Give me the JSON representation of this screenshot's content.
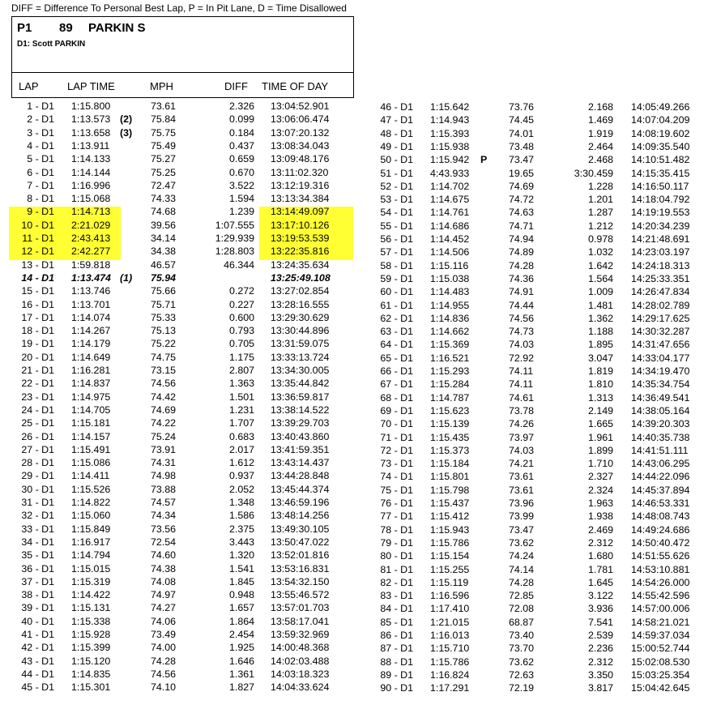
{
  "legend": "DIFF = Difference To Personal Best Lap,   P = In Pit Lane,   D = Time Disallowed",
  "header": {
    "position": "P1",
    "car_number": "89",
    "name": "PARKIN S",
    "driver": "D1:    Scott PARKIN"
  },
  "columns": {
    "lap": "LAP",
    "lap_time": "LAP TIME",
    "mph": "MPH",
    "diff": "DIFF",
    "time_of_day": "TIME OF DAY"
  },
  "colors": {
    "highlight": "#ffff33"
  },
  "laps_left": [
    {
      "lap": "1 - D1",
      "time": "1:15.800",
      "flag": "",
      "mph": "73.61",
      "diff": "2.326",
      "tod": "13:04:52.901"
    },
    {
      "lap": "2 - D1",
      "time": "1:13.573",
      "flag": "(2)",
      "mph": "75.84",
      "diff": "0.099",
      "tod": "13:06:06.474"
    },
    {
      "lap": "3 - D1",
      "time": "1:13.658",
      "flag": "(3)",
      "mph": "75.75",
      "diff": "0.184",
      "tod": "13:07:20.132"
    },
    {
      "lap": "4 - D1",
      "time": "1:13.911",
      "flag": "",
      "mph": "75.49",
      "diff": "0.437",
      "tod": "13:08:34.043"
    },
    {
      "lap": "5 - D1",
      "time": "1:14.133",
      "flag": "",
      "mph": "75.27",
      "diff": "0.659",
      "tod": "13:09:48.176"
    },
    {
      "lap": "6 - D1",
      "time": "1:14.144",
      "flag": "",
      "mph": "75.25",
      "diff": "0.670",
      "tod": "13:11:02.320"
    },
    {
      "lap": "7 - D1",
      "time": "1:16.996",
      "flag": "",
      "mph": "72.47",
      "diff": "3.522",
      "tod": "13:12:19.316"
    },
    {
      "lap": "8 - D1",
      "time": "1:15.068",
      "flag": "",
      "mph": "74.33",
      "diff": "1.594",
      "tod": "13:13:34.384"
    },
    {
      "lap": "9 - D1",
      "time": "1:14.713",
      "flag": "",
      "mph": "74.68",
      "diff": "1.239",
      "tod": "13:14:49.097"
    },
    {
      "lap": "10 - D1",
      "time": "2:21.029",
      "flag": "",
      "mph": "39.56",
      "diff": "1:07.555",
      "tod": "13:17:10.126"
    },
    {
      "lap": "11 - D1",
      "time": "2:43.413",
      "flag": "",
      "mph": "34.14",
      "diff": "1:29.939",
      "tod": "13:19:53.539"
    },
    {
      "lap": "12 - D1",
      "time": "2:42.277",
      "flag": "",
      "mph": "34.38",
      "diff": "1:28.803",
      "tod": "13:22:35.816"
    },
    {
      "lap": "13 - D1",
      "time": "1:59.818",
      "flag": "",
      "mph": "46.57",
      "diff": "46.344",
      "tod": "13:24:35.634"
    },
    {
      "lap": "14 - D1",
      "time": "1:13.474",
      "flag": "(1)",
      "mph": "75.94",
      "diff": "",
      "tod": "13:25:49.108",
      "best": true
    },
    {
      "lap": "15 - D1",
      "time": "1:13.746",
      "flag": "",
      "mph": "75.66",
      "diff": "0.272",
      "tod": "13:27:02.854"
    },
    {
      "lap": "16 - D1",
      "time": "1:13.701",
      "flag": "",
      "mph": "75.71",
      "diff": "0.227",
      "tod": "13:28:16.555"
    },
    {
      "lap": "17 - D1",
      "time": "1:14.074",
      "flag": "",
      "mph": "75.33",
      "diff": "0.600",
      "tod": "13:29:30.629"
    },
    {
      "lap": "18 - D1",
      "time": "1:14.267",
      "flag": "",
      "mph": "75.13",
      "diff": "0.793",
      "tod": "13:30:44.896"
    },
    {
      "lap": "19 - D1",
      "time": "1:14.179",
      "flag": "",
      "mph": "75.22",
      "diff": "0.705",
      "tod": "13:31:59.075"
    },
    {
      "lap": "20 - D1",
      "time": "1:14.649",
      "flag": "",
      "mph": "74.75",
      "diff": "1.175",
      "tod": "13:33:13.724"
    },
    {
      "lap": "21 - D1",
      "time": "1:16.281",
      "flag": "",
      "mph": "73.15",
      "diff": "2.807",
      "tod": "13:34:30.005"
    },
    {
      "lap": "22 - D1",
      "time": "1:14.837",
      "flag": "",
      "mph": "74.56",
      "diff": "1.363",
      "tod": "13:35:44.842"
    },
    {
      "lap": "23 - D1",
      "time": "1:14.975",
      "flag": "",
      "mph": "74.42",
      "diff": "1.501",
      "tod": "13:36:59.817"
    },
    {
      "lap": "24 - D1",
      "time": "1:14.705",
      "flag": "",
      "mph": "74.69",
      "diff": "1.231",
      "tod": "13:38:14.522"
    },
    {
      "lap": "25 - D1",
      "time": "1:15.181",
      "flag": "",
      "mph": "74.22",
      "diff": "1.707",
      "tod": "13:39:29.703"
    },
    {
      "lap": "26 - D1",
      "time": "1:14.157",
      "flag": "",
      "mph": "75.24",
      "diff": "0.683",
      "tod": "13:40:43.860"
    },
    {
      "lap": "27 - D1",
      "time": "1:15.491",
      "flag": "",
      "mph": "73.91",
      "diff": "2.017",
      "tod": "13:41:59.351"
    },
    {
      "lap": "28 - D1",
      "time": "1:15.086",
      "flag": "",
      "mph": "74.31",
      "diff": "1.612",
      "tod": "13:43:14.437"
    },
    {
      "lap": "29 - D1",
      "time": "1:14.411",
      "flag": "",
      "mph": "74.98",
      "diff": "0.937",
      "tod": "13:44:28.848"
    },
    {
      "lap": "30 - D1",
      "time": "1:15.526",
      "flag": "",
      "mph": "73.88",
      "diff": "2.052",
      "tod": "13:45:44.374"
    },
    {
      "lap": "31 - D1",
      "time": "1:14.822",
      "flag": "",
      "mph": "74.57",
      "diff": "1.348",
      "tod": "13:46:59.196"
    },
    {
      "lap": "32 - D1",
      "time": "1:15.060",
      "flag": "",
      "mph": "74.34",
      "diff": "1.586",
      "tod": "13:48:14.256"
    },
    {
      "lap": "33 - D1",
      "time": "1:15.849",
      "flag": "",
      "mph": "73.56",
      "diff": "2.375",
      "tod": "13:49:30.105"
    },
    {
      "lap": "34 - D1",
      "time": "1:16.917",
      "flag": "",
      "mph": "72.54",
      "diff": "3.443",
      "tod": "13:50:47.022"
    },
    {
      "lap": "35 - D1",
      "time": "1:14.794",
      "flag": "",
      "mph": "74.60",
      "diff": "1.320",
      "tod": "13:52:01.816"
    },
    {
      "lap": "36 - D1",
      "time": "1:15.015",
      "flag": "",
      "mph": "74.38",
      "diff": "1.541",
      "tod": "13:53:16.831"
    },
    {
      "lap": "37 - D1",
      "time": "1:15.319",
      "flag": "",
      "mph": "74.08",
      "diff": "1.845",
      "tod": "13:54:32.150"
    },
    {
      "lap": "38 - D1",
      "time": "1:14.422",
      "flag": "",
      "mph": "74.97",
      "diff": "0.948",
      "tod": "13:55:46.572"
    },
    {
      "lap": "39 - D1",
      "time": "1:15.131",
      "flag": "",
      "mph": "74.27",
      "diff": "1.657",
      "tod": "13:57:01.703"
    },
    {
      "lap": "40 - D1",
      "time": "1:15.338",
      "flag": "",
      "mph": "74.06",
      "diff": "1.864",
      "tod": "13:58:17.041"
    },
    {
      "lap": "41 - D1",
      "time": "1:15.928",
      "flag": "",
      "mph": "73.49",
      "diff": "2.454",
      "tod": "13:59:32.969"
    },
    {
      "lap": "42 - D1",
      "time": "1:15.399",
      "flag": "",
      "mph": "74.00",
      "diff": "1.925",
      "tod": "14:00:48.368"
    },
    {
      "lap": "43 - D1",
      "time": "1:15.120",
      "flag": "",
      "mph": "74.28",
      "diff": "1.646",
      "tod": "14:02:03.488"
    },
    {
      "lap": "44 - D1",
      "time": "1:14.835",
      "flag": "",
      "mph": "74.56",
      "diff": "1.361",
      "tod": "14:03:18.323"
    },
    {
      "lap": "45 - D1",
      "time": "1:15.301",
      "flag": "",
      "mph": "74.10",
      "diff": "1.827",
      "tod": "14:04:33.624"
    }
  ],
  "laps_right": [
    {
      "lap": "46 - D1",
      "time": "1:15.642",
      "flag": "",
      "mph": "73.76",
      "diff": "2.168",
      "tod": "14:05:49.266"
    },
    {
      "lap": "47 - D1",
      "time": "1:14.943",
      "flag": "",
      "mph": "74.45",
      "diff": "1.469",
      "tod": "14:07:04.209"
    },
    {
      "lap": "48 - D1",
      "time": "1:15.393",
      "flag": "",
      "mph": "74.01",
      "diff": "1.919",
      "tod": "14:08:19.602"
    },
    {
      "lap": "49 - D1",
      "time": "1:15.938",
      "flag": "",
      "mph": "73.48",
      "diff": "2.464",
      "tod": "14:09:35.540"
    },
    {
      "lap": "50 - D1",
      "time": "1:15.942",
      "flag": "P",
      "mph": "73.47",
      "diff": "2.468",
      "tod": "14:10:51.482"
    },
    {
      "lap": "51 - D1",
      "time": "4:43.933",
      "flag": "",
      "mph": "19.65",
      "diff": "3:30.459",
      "tod": "14:15:35.415"
    },
    {
      "lap": "52 - D1",
      "time": "1:14.702",
      "flag": "",
      "mph": "74.69",
      "diff": "1.228",
      "tod": "14:16:50.117"
    },
    {
      "lap": "53 - D1",
      "time": "1:14.675",
      "flag": "",
      "mph": "74.72",
      "diff": "1.201",
      "tod": "14:18:04.792"
    },
    {
      "lap": "54 - D1",
      "time": "1:14.761",
      "flag": "",
      "mph": "74.63",
      "diff": "1.287",
      "tod": "14:19:19.553"
    },
    {
      "lap": "55 - D1",
      "time": "1:14.686",
      "flag": "",
      "mph": "74.71",
      "diff": "1.212",
      "tod": "14:20:34.239"
    },
    {
      "lap": "56 - D1",
      "time": "1:14.452",
      "flag": "",
      "mph": "74.94",
      "diff": "0.978",
      "tod": "14:21:48.691"
    },
    {
      "lap": "57 - D1",
      "time": "1:14.506",
      "flag": "",
      "mph": "74.89",
      "diff": "1.032",
      "tod": "14:23:03.197"
    },
    {
      "lap": "58 - D1",
      "time": "1:15.116",
      "flag": "",
      "mph": "74.28",
      "diff": "1.642",
      "tod": "14:24:18.313"
    },
    {
      "lap": "59 - D1",
      "time": "1:15.038",
      "flag": "",
      "mph": "74.36",
      "diff": "1.564",
      "tod": "14:25:33.351"
    },
    {
      "lap": "60 - D1",
      "time": "1:14.483",
      "flag": "",
      "mph": "74.91",
      "diff": "1.009",
      "tod": "14:26:47.834"
    },
    {
      "lap": "61 - D1",
      "time": "1:14.955",
      "flag": "",
      "mph": "74.44",
      "diff": "1.481",
      "tod": "14:28:02.789"
    },
    {
      "lap": "62 - D1",
      "time": "1:14.836",
      "flag": "",
      "mph": "74.56",
      "diff": "1.362",
      "tod": "14:29:17.625"
    },
    {
      "lap": "63 - D1",
      "time": "1:14.662",
      "flag": "",
      "mph": "74.73",
      "diff": "1.188",
      "tod": "14:30:32.287"
    },
    {
      "lap": "64 - D1",
      "time": "1:15.369",
      "flag": "",
      "mph": "74.03",
      "diff": "1.895",
      "tod": "14:31:47.656"
    },
    {
      "lap": "65 - D1",
      "time": "1:16.521",
      "flag": "",
      "mph": "72.92",
      "diff": "3.047",
      "tod": "14:33:04.177"
    },
    {
      "lap": "66 - D1",
      "time": "1:15.293",
      "flag": "",
      "mph": "74.11",
      "diff": "1.819",
      "tod": "14:34:19.470"
    },
    {
      "lap": "67 - D1",
      "time": "1:15.284",
      "flag": "",
      "mph": "74.11",
      "diff": "1.810",
      "tod": "14:35:34.754"
    },
    {
      "lap": "68 - D1",
      "time": "1:14.787",
      "flag": "",
      "mph": "74.61",
      "diff": "1.313",
      "tod": "14:36:49.541"
    },
    {
      "lap": "69 - D1",
      "time": "1:15.623",
      "flag": "",
      "mph": "73.78",
      "diff": "2.149",
      "tod": "14:38:05.164"
    },
    {
      "lap": "70 - D1",
      "time": "1:15.139",
      "flag": "",
      "mph": "74.26",
      "diff": "1.665",
      "tod": "14:39:20.303"
    },
    {
      "lap": "71 - D1",
      "time": "1:15.435",
      "flag": "",
      "mph": "73.97",
      "diff": "1.961",
      "tod": "14:40:35.738"
    },
    {
      "lap": "72 - D1",
      "time": "1:15.373",
      "flag": "",
      "mph": "74.03",
      "diff": "1.899",
      "tod": "14:41:51.111"
    },
    {
      "lap": "73 - D1",
      "time": "1:15.184",
      "flag": "",
      "mph": "74.21",
      "diff": "1.710",
      "tod": "14:43:06.295"
    },
    {
      "lap": "74 - D1",
      "time": "1:15.801",
      "flag": "",
      "mph": "73.61",
      "diff": "2.327",
      "tod": "14:44:22.096"
    },
    {
      "lap": "75 - D1",
      "time": "1:15.798",
      "flag": "",
      "mph": "73.61",
      "diff": "2.324",
      "tod": "14:45:37.894"
    },
    {
      "lap": "76 - D1",
      "time": "1:15.437",
      "flag": "",
      "mph": "73.96",
      "diff": "1.963",
      "tod": "14:46:53.331"
    },
    {
      "lap": "77 - D1",
      "time": "1:15.412",
      "flag": "",
      "mph": "73.99",
      "diff": "1.938",
      "tod": "14:48:08.743"
    },
    {
      "lap": "78 - D1",
      "time": "1:15.943",
      "flag": "",
      "mph": "73.47",
      "diff": "2.469",
      "tod": "14:49:24.686"
    },
    {
      "lap": "79 - D1",
      "time": "1:15.786",
      "flag": "",
      "mph": "73.62",
      "diff": "2.312",
      "tod": "14:50:40.472"
    },
    {
      "lap": "80 - D1",
      "time": "1:15.154",
      "flag": "",
      "mph": "74.24",
      "diff": "1.680",
      "tod": "14:51:55.626"
    },
    {
      "lap": "81 - D1",
      "time": "1:15.255",
      "flag": "",
      "mph": "74.14",
      "diff": "1.781",
      "tod": "14:53:10.881"
    },
    {
      "lap": "82 - D1",
      "time": "1:15.119",
      "flag": "",
      "mph": "74.28",
      "diff": "1.645",
      "tod": "14:54:26.000"
    },
    {
      "lap": "83 - D1",
      "time": "1:16.596",
      "flag": "",
      "mph": "72.85",
      "diff": "3.122",
      "tod": "14:55:42.596"
    },
    {
      "lap": "84 - D1",
      "time": "1:17.410",
      "flag": "",
      "mph": "72.08",
      "diff": "3.936",
      "tod": "14:57:00.006"
    },
    {
      "lap": "85 - D1",
      "time": "1:21.015",
      "flag": "",
      "mph": "68.87",
      "diff": "7.541",
      "tod": "14:58:21.021"
    },
    {
      "lap": "86 - D1",
      "time": "1:16.013",
      "flag": "",
      "mph": "73.40",
      "diff": "2.539",
      "tod": "14:59:37.034"
    },
    {
      "lap": "87 - D1",
      "time": "1:15.710",
      "flag": "",
      "mph": "73.70",
      "diff": "2.236",
      "tod": "15:00:52.744"
    },
    {
      "lap": "88 - D1",
      "time": "1:15.786",
      "flag": "",
      "mph": "73.62",
      "diff": "2.312",
      "tod": "15:02:08.530"
    },
    {
      "lap": "89 - D1",
      "time": "1:16.824",
      "flag": "",
      "mph": "72.63",
      "diff": "3.350",
      "tod": "15:03:25.354"
    },
    {
      "lap": "90 - D1",
      "time": "1:17.291",
      "flag": "",
      "mph": "72.19",
      "diff": "3.817",
      "tod": "15:04:42.645"
    }
  ]
}
